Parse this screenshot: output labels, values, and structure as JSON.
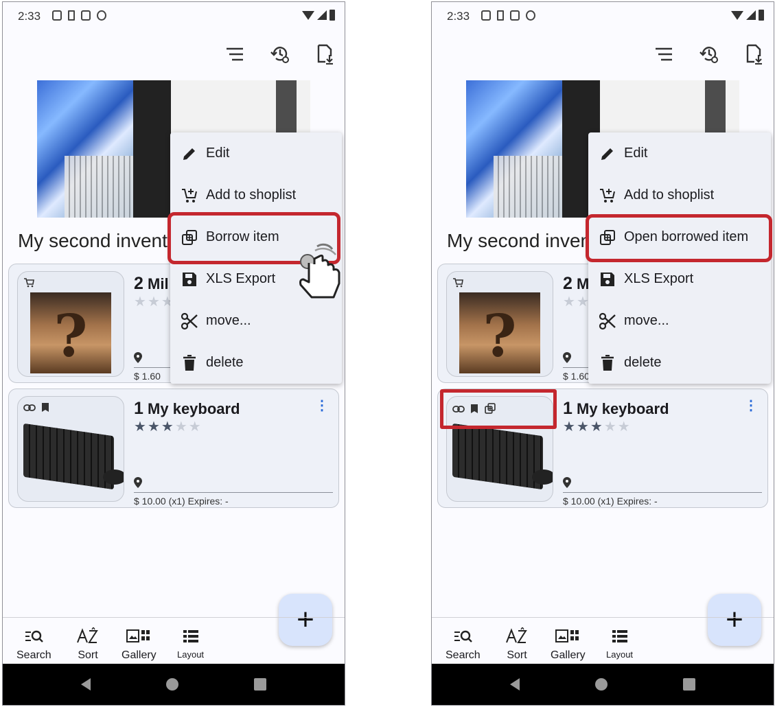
{
  "left": {
    "status_time": "2:33",
    "inventory_title": "My second inventory",
    "menu": [
      {
        "label": "Edit",
        "icon": "pencil-icon"
      },
      {
        "label": "Add to shoplist",
        "icon": "add-cart-icon"
      },
      {
        "label": "Borrow item",
        "icon": "borrow-icon"
      },
      {
        "label": "XLS Export",
        "icon": "save-icon"
      },
      {
        "label": "move...",
        "icon": "scissors-icon"
      },
      {
        "label": "delete",
        "icon": "trash-icon"
      }
    ],
    "items": [
      {
        "qty": "2",
        "name": "Mil",
        "price_line": "$ 1.60",
        "rating": 3
      },
      {
        "qty": "1",
        "name": "My keyboard",
        "price_line": "$ 10.00  (x1)   Expires: -",
        "rating": 3
      }
    ],
    "tabs": [
      {
        "label": "Search",
        "icon": "search-list-icon"
      },
      {
        "label": "Sort",
        "icon": "sort-az-icon"
      },
      {
        "label": "Gallery",
        "icon": "gallery-icon"
      },
      {
        "label": "Layout",
        "icon": "layout-list-icon"
      }
    ],
    "fab_label": "+"
  },
  "right": {
    "status_time": "2:33",
    "inventory_title": "My second inventory",
    "menu": [
      {
        "label": "Edit",
        "icon": "pencil-icon"
      },
      {
        "label": "Add to shoplist",
        "icon": "add-cart-icon"
      },
      {
        "label": "Open borrowed item",
        "icon": "borrow-icon"
      },
      {
        "label": "XLS Export",
        "icon": "save-icon"
      },
      {
        "label": "move...",
        "icon": "scissors-icon"
      },
      {
        "label": "delete",
        "icon": "trash-icon"
      }
    ],
    "items": [
      {
        "qty": "2",
        "name": "M",
        "price_line": "$ 1.60",
        "rating": 3
      },
      {
        "qty": "1",
        "name": "My keyboard",
        "price_line": "$ 10.00  (x1)   Expires: -",
        "rating": 3
      }
    ],
    "tabs": [
      {
        "label": "Search",
        "icon": "search-list-icon"
      },
      {
        "label": "Sort",
        "icon": "sort-az-icon"
      },
      {
        "label": "Gallery",
        "icon": "gallery-icon"
      },
      {
        "label": "Layout",
        "icon": "layout-list-icon"
      }
    ],
    "fab_label": "+"
  },
  "colors": {
    "highlight": "#c4272e",
    "card_bg": "#eef1f8",
    "fab_bg": "#d8e4fc",
    "menu_bg": "#eef0f6",
    "more_dots": "#2a6ad8"
  }
}
